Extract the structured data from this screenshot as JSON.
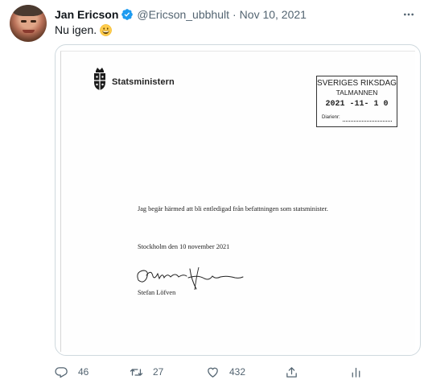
{
  "tweet": {
    "author_name": "Jan Ericson",
    "handle": "@Ericson_ubbhult",
    "separator": "·",
    "date": "Nov 10, 2021",
    "text": "Nu igen.",
    "emoji": "grinning-face-emoji"
  },
  "document": {
    "office": "Statsministern",
    "stamp": {
      "line1": "SVERIGES RIKSDAG",
      "line2": "TALMANNEN",
      "line3": "2021 -11- 1 0",
      "line4": "Diarienr:"
    },
    "body": "Jag begär härmed att bli entledigad från befattningen som statsminister.",
    "place_date": "Stockholm den 10 november 2021",
    "signer": "Stefan Löfven"
  },
  "actions": {
    "reply_count": "46",
    "retweet_count": "27",
    "like_count": "432"
  },
  "colors": {
    "text": "#0f1419",
    "secondary": "#536471",
    "verified": "#1d9bf0",
    "border": "#cfd9de"
  }
}
